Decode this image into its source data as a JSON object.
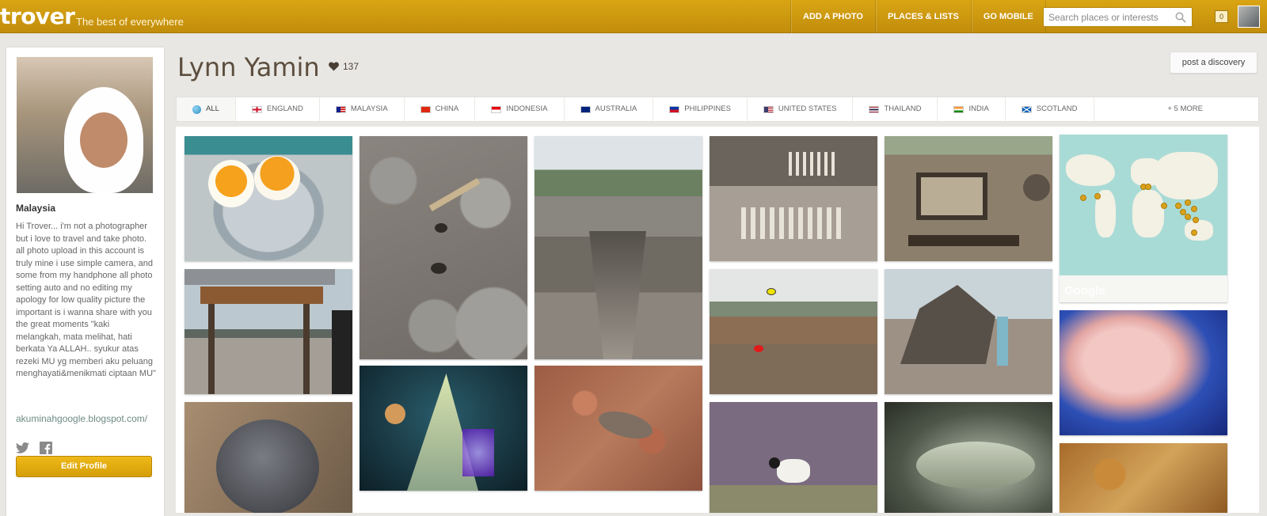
{
  "brand": {
    "logo": "trover",
    "tagline": "The best of everywhere"
  },
  "nav": [
    "ADD A PHOTO",
    "PLACES & LISTS",
    "GO MOBILE"
  ],
  "search": {
    "placeholder": "Search places or interests"
  },
  "notifications": {
    "count": "0"
  },
  "profile": {
    "country": "Malaysia",
    "bio": "Hi Trover... i'm not a photographer but i love to travel and take photo. all photo upload in this account is truly mine i use simple camera, and some from my handphone all photo setting auto and no editing my apology for low quality picture the important is i wanna share with you the great moments \"kaki melangkah, mata melihat, hati berkata Ya ALLAH.. syukur atas rezeki MU yg memberi aku peluang menghayati&menikmati ciptaan MU\"",
    "blog": "akuminahgoogle.blogspot.com/",
    "edit_label": "Edit Profile"
  },
  "header": {
    "name": "Lynn Yamin",
    "likes": "137",
    "post_label": "post a discovery"
  },
  "tabs": [
    {
      "label": "ALL",
      "icon": "globe-icon"
    },
    {
      "label": "ENGLAND",
      "icon": "flag-england-icon"
    },
    {
      "label": "MALAYSIA",
      "icon": "flag-malaysia-icon"
    },
    {
      "label": "CHINA",
      "icon": "flag-china-icon"
    },
    {
      "label": "INDONESIA",
      "icon": "flag-indonesia-icon"
    },
    {
      "label": "AUSTRALIA",
      "icon": "flag-australia-icon"
    },
    {
      "label": "PHILIPPINES",
      "icon": "flag-philippines-icon"
    },
    {
      "label": "UNITED STATES",
      "icon": "flag-usa-icon"
    },
    {
      "label": "THAILAND",
      "icon": "flag-thailand-icon"
    },
    {
      "label": "INDIA",
      "icon": "flag-india-icon"
    },
    {
      "label": "SCOTLAND",
      "icon": "flag-scotland-icon"
    }
  ],
  "more_label": "+ 5 MORE",
  "map": {
    "label": "Google"
  },
  "colors": {
    "brand": "#d09a0d",
    "accent_link": "#6e8b84"
  }
}
